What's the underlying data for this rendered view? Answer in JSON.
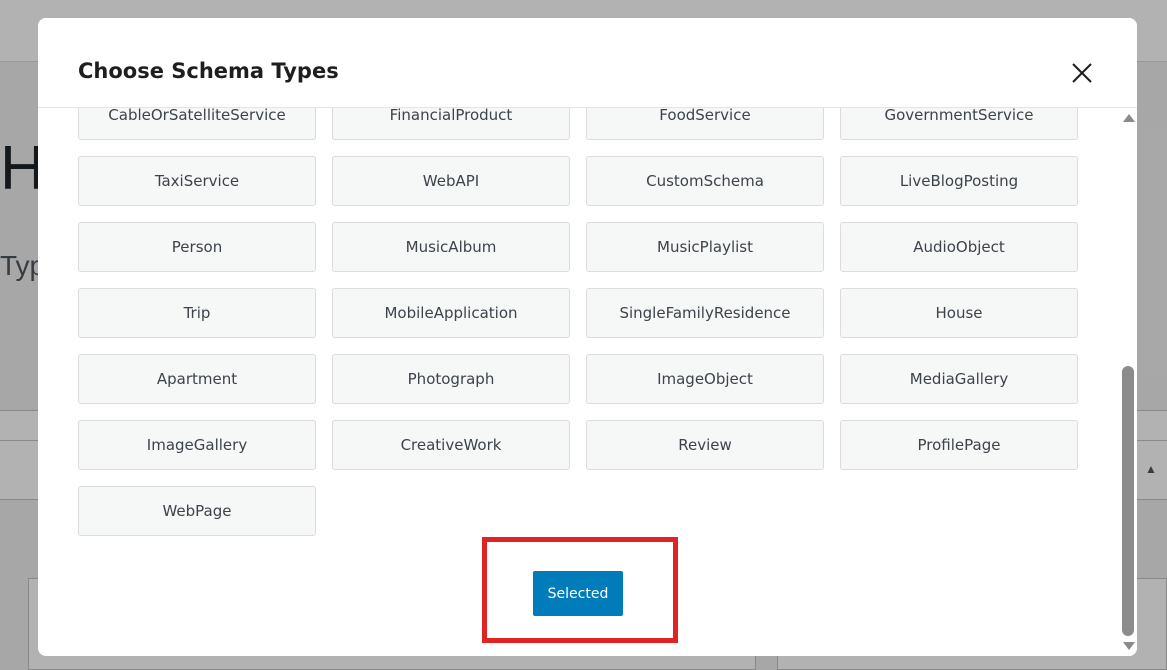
{
  "background": {
    "heading": "H",
    "subtext": "Typ"
  },
  "modal": {
    "title": "Choose Schema Types",
    "close_icon": "close-icon",
    "schema_types": [
      "CableOrSatelliteService",
      "FinancialProduct",
      "FoodService",
      "GovernmentService",
      "TaxiService",
      "WebAPI",
      "CustomSchema",
      "LiveBlogPosting",
      "Person",
      "MusicAlbum",
      "MusicPlaylist",
      "AudioObject",
      "Trip",
      "MobileApplication",
      "SingleFamilyResidence",
      "House",
      "Apartment",
      "Photograph",
      "ImageObject",
      "MediaGallery",
      "ImageGallery",
      "CreativeWork",
      "Review",
      "ProfilePage",
      "WebPage"
    ],
    "selected_button_label": "Selected"
  },
  "colors": {
    "primary_button": "#007cba",
    "highlight_box": "#e02424",
    "schema_button_bg": "#f6f7f7"
  }
}
